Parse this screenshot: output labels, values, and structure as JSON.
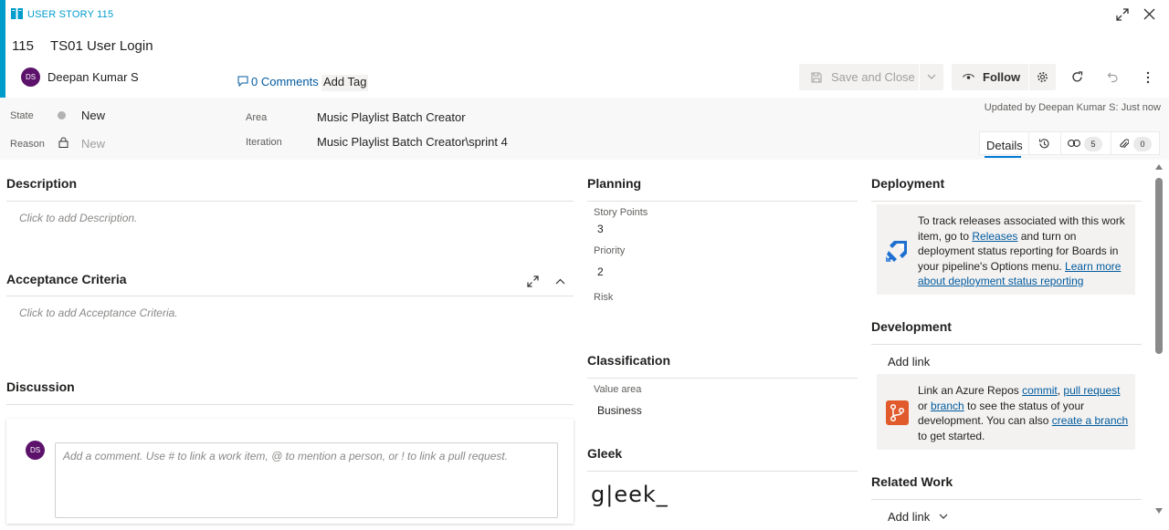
{
  "header": {
    "type_label": "USER STORY 115",
    "id": "115",
    "title": "TS01 User Login",
    "assignee_initials": "DS",
    "assignee_name": "Deepan Kumar S",
    "comments_label": "0 Comments",
    "add_tag_label": "Add Tag",
    "save_close_label": "Save and Close",
    "follow_label": "Follow",
    "icons": [
      "book-icon",
      "expand-icon",
      "close-icon",
      "comment-icon",
      "save-icon",
      "chevron-down-icon",
      "eye-icon",
      "gear-icon",
      "refresh-icon",
      "undo-icon",
      "more-vertical-icon"
    ]
  },
  "fields": {
    "state_label": "State",
    "state_value": "New",
    "reason_label": "Reason",
    "reason_value": "New",
    "area_label": "Area",
    "area_value": "Music Playlist Batch Creator",
    "iteration_label": "Iteration",
    "iteration_value": "Music Playlist Batch Creator\\sprint 4",
    "updated_text": "Updated by Deepan Kumar S: Just now"
  },
  "tabs": {
    "details_label": "Details",
    "links_count": "5",
    "attachments_count": "0"
  },
  "left": {
    "description_title": "Description",
    "description_hint": "Click to add Description.",
    "acceptance_title": "Acceptance Criteria",
    "acceptance_hint": "Click to add Acceptance Criteria.",
    "discussion_title": "Discussion",
    "comment_avatar": "DS",
    "comment_placeholder": "Add a comment. Use # to link a work item, @ to mention a person, or ! to link a pull request."
  },
  "planning": {
    "title": "Planning",
    "story_points_label": "Story Points",
    "story_points_value": "3",
    "priority_label": "Priority",
    "priority_value": "2",
    "risk_label": "Risk",
    "classification_title": "Classification",
    "value_area_label": "Value area",
    "value_area_value": "Business",
    "gleek_title": "Gleek",
    "gleek_logo_text": "g|eek_"
  },
  "right": {
    "deployment_title": "Deployment",
    "deploy_text_1": "To track releases associated with this work item, go to ",
    "deploy_link_1": "Releases",
    "deploy_text_2": " and turn on deployment status reporting for Boards in your pipeline's Options menu. ",
    "deploy_link_2": "Learn more about deployment status reporting",
    "development_title": "Development",
    "dev_add_link": "Add link",
    "dev_text_1": "Link an Azure Repos ",
    "dev_link_commit": "commit",
    "dev_text_comma": ", ",
    "dev_link_pr": "pull request",
    "dev_text_or": " or ",
    "dev_link_branch": "branch",
    "dev_text_2": " to see the status of your development. You can also ",
    "dev_link_create": "create a branch",
    "dev_text_3": " to get started.",
    "related_title": "Related Work",
    "related_add_link": "Add link"
  },
  "colors": {
    "accent": "#009ccc",
    "avatar": "#5c126b",
    "link": "#005a9e"
  }
}
